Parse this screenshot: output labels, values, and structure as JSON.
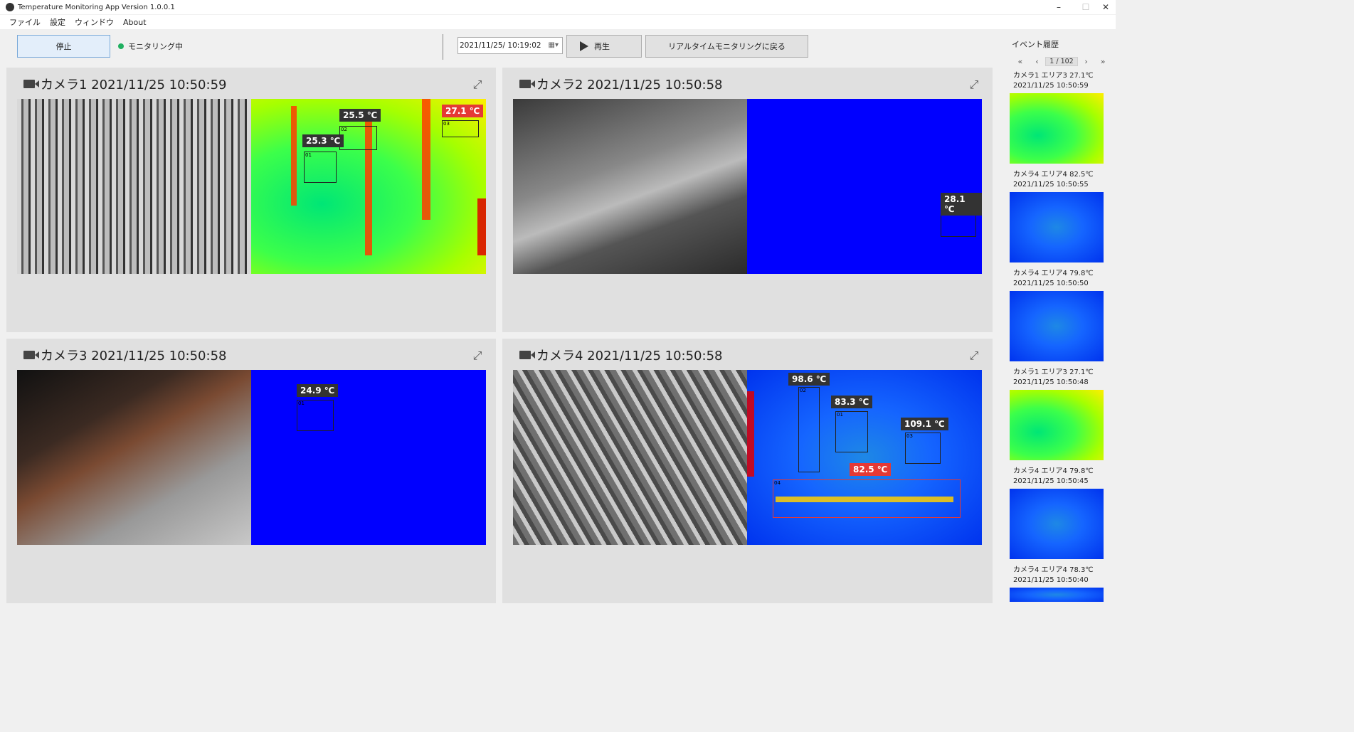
{
  "window": {
    "title": "Temperature Monitoring App Version 1.0.0.1",
    "minimize": "–",
    "maximize": "☐",
    "close": "✕"
  },
  "menu": [
    "ファイル",
    "設定",
    "ウィンドウ",
    "About"
  ],
  "toolbar": {
    "stop_label": "停止",
    "status_text": "モニタリング中",
    "datetime_value": "2021/11/25/ 10:19:02",
    "play_label": "再生",
    "realtime_label": "リアルタイムモニタリングに戻る"
  },
  "cameras": [
    {
      "title": "カメラ1 2021/11/25 10:50:59",
      "labels": [
        "25.5 ℃",
        "27.1 ℃",
        "25.3 ℃"
      ],
      "roi_ids": [
        "02",
        "03",
        "01"
      ]
    },
    {
      "title": "カメラ2 2021/11/25 10:50:58",
      "labels": [
        "28.1 ℃"
      ],
      "roi_ids": [
        "01"
      ]
    },
    {
      "title": "カメラ3 2021/11/25 10:50:58",
      "labels": [
        "24.9 ℃"
      ],
      "roi_ids": [
        "01"
      ]
    },
    {
      "title": "カメラ4 2021/11/25 10:50:58",
      "labels": [
        "98.6 ℃",
        "83.3 ℃",
        "109.1 ℃",
        "82.5 ℃"
      ],
      "roi_ids": [
        "02",
        "01",
        "03",
        "04"
      ]
    }
  ],
  "sidebar": {
    "title": "イベント履歴",
    "pager": {
      "first": "«",
      "prev": "‹",
      "page": "1 / 102",
      "next": "›",
      "last": "»"
    },
    "events": [
      {
        "line1": "カメラ1 エリア3 27.1℃",
        "line2": "2021/11/25 10:50:59",
        "thumb": "green"
      },
      {
        "line1": "カメラ4 エリア4 82.5℃",
        "line2": "2021/11/25 10:50:55",
        "thumb": "blue"
      },
      {
        "line1": "カメラ4 エリア4 79.8℃",
        "line2": "2021/11/25 10:50:50",
        "thumb": "blue"
      },
      {
        "line1": "カメラ1 エリア3 27.1℃",
        "line2": "2021/11/25 10:50:48",
        "thumb": "green"
      },
      {
        "line1": "カメラ4 エリア4 79.8℃",
        "line2": "2021/11/25 10:50:45",
        "thumb": "blue"
      },
      {
        "line1": "カメラ4 エリア4 78.3℃",
        "line2": "2021/11/25 10:50:40",
        "thumb": "blue"
      }
    ]
  },
  "colors": {
    "status_dot": "#20b060",
    "alert_label": "#e53935",
    "thermal_blue": "#0000ff"
  }
}
